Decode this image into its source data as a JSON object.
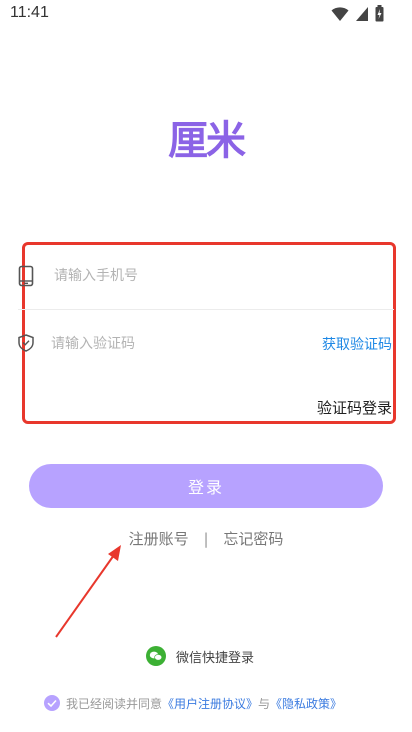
{
  "status_bar": {
    "time": "11:41"
  },
  "logo": {
    "text": "厘米",
    "color": "#8b63e6"
  },
  "phone_field": {
    "placeholder": "请输入手机号"
  },
  "code_field": {
    "placeholder": "请输入验证码"
  },
  "get_code_label": "获取验证码",
  "code_login_label": "验证码登录",
  "login_button_label": "登录",
  "links": {
    "register": "注册账号",
    "separator": "|",
    "forgot": "忘记密码"
  },
  "wechat_login_label": "微信快捷登录",
  "agreement": {
    "prefix": "我已经阅读并同意",
    "user_agreement": "《用户注册协议》",
    "and": "与",
    "privacy_policy": "《隐私政策》"
  },
  "colors": {
    "accent": "#b7a2ff",
    "logo": "#8b63e6",
    "link": "#1e88e5",
    "highlight": "#e8372c",
    "wechat": "#3cb034"
  },
  "icons": [
    "wifi-icon",
    "signal-icon",
    "battery-icon",
    "phone-icon",
    "shield-icon",
    "wechat-icon",
    "check-icon",
    "arrow-annotation"
  ]
}
